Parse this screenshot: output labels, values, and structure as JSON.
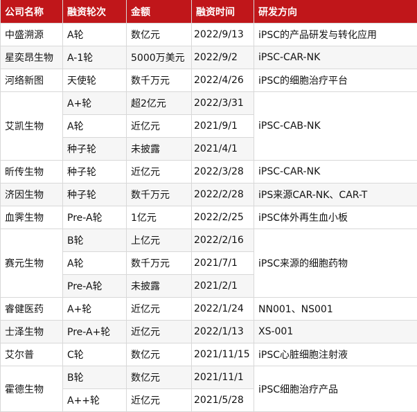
{
  "headers": [
    "公司名称",
    "融资轮次",
    "金额",
    "融资时间",
    "研发方向"
  ],
  "groups": [
    {
      "company": "中盛溯源",
      "direction": "iPSC的产品研发与转化应用",
      "rounds": [
        {
          "round": "A轮",
          "amount": "数亿元",
          "date": "2022/9/13"
        }
      ]
    },
    {
      "company": "星奕昂生物",
      "direction": "iPSC-CAR-NK",
      "rounds": [
        {
          "round": "A-1轮",
          "amount": "5000万美元",
          "date": "2022/9/2"
        }
      ]
    },
    {
      "company": "河络新图",
      "direction": "iPSC的细胞治疗平台",
      "rounds": [
        {
          "round": "天使轮",
          "amount": "数千万元",
          "date": "2022/4/26"
        }
      ]
    },
    {
      "company": "艾凯生物",
      "direction": "iPSC-CAB-NK",
      "rounds": [
        {
          "round": "A+轮",
          "amount": "超2亿元",
          "date": "2022/3/31"
        },
        {
          "round": "A轮",
          "amount": "近亿元",
          "date": "2021/9/1"
        },
        {
          "round": "种子轮",
          "amount": "未披露",
          "date": "2021/4/1"
        }
      ]
    },
    {
      "company": "昕传生物",
      "direction": "iPSC-CAR-NK",
      "rounds": [
        {
          "round": "种子轮",
          "amount": "近亿元",
          "date": "2022/3/28"
        }
      ]
    },
    {
      "company": "济因生物",
      "direction": "iPS来源CAR-NK、CAR-T",
      "rounds": [
        {
          "round": "种子轮",
          "amount": "数千万元",
          "date": "2022/2/28"
        }
      ]
    },
    {
      "company": "血霁生物",
      "direction": "iPSC体外再生血小板",
      "rounds": [
        {
          "round": "Pre-A轮",
          "amount": "1亿元",
          "date": "2022/2/25"
        }
      ]
    },
    {
      "company": "赛元生物",
      "direction": "iPSC来源的细胞药物",
      "rounds": [
        {
          "round": "B轮",
          "amount": "上亿元",
          "date": "2022/2/16"
        },
        {
          "round": "A轮",
          "amount": "数千万元",
          "date": "2021/7/1"
        },
        {
          "round": "Pre-A轮",
          "amount": "未披露",
          "date": "2021/2/1"
        }
      ]
    },
    {
      "company": "睿健医药",
      "direction": "NN001、NS001",
      "rounds": [
        {
          "round": "A+轮",
          "amount": "近亿元",
          "date": "2022/1/24"
        }
      ]
    },
    {
      "company": "士泽生物",
      "direction": "XS-001",
      "rounds": [
        {
          "round": "Pre-A+轮",
          "amount": "近亿元",
          "date": "2022/1/13"
        }
      ]
    },
    {
      "company": "艾尔普",
      "direction": "iPSC心脏细胞注射液",
      "rounds": [
        {
          "round": "C轮",
          "amount": "数亿元",
          "date": "2021/11/15"
        }
      ]
    },
    {
      "company": "霍德生物",
      "direction": "iPSC细胞治疗产品",
      "rounds": [
        {
          "round": "B轮",
          "amount": "数亿元",
          "date": "2021/11/1"
        },
        {
          "round": "A++轮",
          "amount": "近亿元",
          "date": "2021/5/28"
        }
      ]
    }
  ]
}
